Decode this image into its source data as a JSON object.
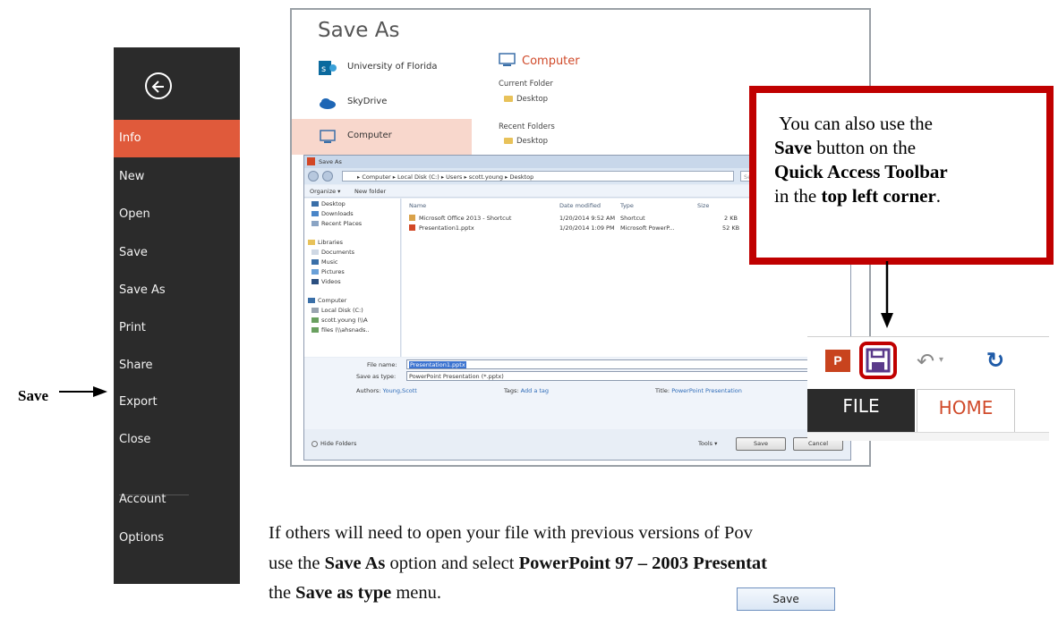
{
  "backstage": {
    "items": [
      {
        "label": "Info",
        "active": true
      },
      {
        "label": "New"
      },
      {
        "label": "Open"
      },
      {
        "label": "Save"
      },
      {
        "label": "Save As"
      },
      {
        "label": "Print"
      },
      {
        "label": "Share"
      },
      {
        "label": "Export"
      },
      {
        "label": "Close"
      },
      {
        "label": "Account"
      },
      {
        "label": "Options"
      }
    ],
    "accent_color": "#e05a3b"
  },
  "annotation": {
    "save_label": "Save"
  },
  "saveas_panel": {
    "title": "Save As",
    "places": [
      {
        "label": "University of Florida",
        "icon": "sharepoint-icon"
      },
      {
        "label": "SkyDrive",
        "icon": "cloud-icon"
      },
      {
        "label": "Computer",
        "icon": "computer-icon"
      }
    ],
    "computer_heading": "Computer",
    "current_folder_label": "Current Folder",
    "current_folder": "Desktop",
    "recent_folders_label": "Recent Folders",
    "recent_folder": "Desktop"
  },
  "dialog": {
    "title": "Save As",
    "address": "▸ Computer ▸ Local Disk (C:) ▸ Users ▸ scott.young ▸ Desktop",
    "search_placeholder": "Se",
    "toolbar": {
      "organize": "Organize ▾",
      "new_folder": "New folder"
    },
    "tree": {
      "favorites": [
        "Desktop",
        "Downloads",
        "Recent Places"
      ],
      "libraries_label": "Libraries",
      "libraries": [
        "Documents",
        "Music",
        "Pictures",
        "Videos"
      ],
      "computer_label": "Computer",
      "drives": [
        "Local Disk (C:)",
        "scott.young (\\\\A",
        "files (\\\\ahsnads.."
      ]
    },
    "columns": {
      "name": "Name",
      "date": "Date modified",
      "type": "Type",
      "size": "Size"
    },
    "files": [
      {
        "name": "Microsoft Office 2013 - Shortcut",
        "date": "1/20/2014 9:52 AM",
        "type": "Shortcut",
        "size": "2 KB"
      },
      {
        "name": "Presentation1.pptx",
        "date": "1/20/2014 1:09 PM",
        "type": "Microsoft PowerP...",
        "size": "52 KB"
      }
    ],
    "file_name_label": "File name:",
    "file_name": "Presentation1.pptx",
    "save_type_label": "Save as type:",
    "save_type": "PowerPoint Presentation (*.pptx)",
    "authors_label": "Authors:",
    "authors": "Young,Scott",
    "tags_label": "Tags:",
    "tags": "Add a tag",
    "title_label": "Title:",
    "title_value": "PowerPoint Presentation",
    "hide_folders": "Hide Folders",
    "tools": "Tools ▾",
    "save_button": "Save",
    "cancel_button": "Cancel"
  },
  "callout": {
    "line1": "You can also use the",
    "line2_bold": "Save",
    "line2_rest": " button on the",
    "line3_bold": "Quick Access Toolbar",
    "line4_pre": "in the ",
    "line4_bold": "top left corner",
    "line4_post": ".",
    "border_color": "#c00000"
  },
  "ribbon": {
    "ppt_icon": "P",
    "file_tab": "FILE",
    "home_tab": "HOME"
  },
  "body_text": {
    "line1": "If others will need to open your file with previous versions of Pov",
    "line2_pre": "use the ",
    "line2_bold1": "Save As",
    "line2_mid": " option and select ",
    "line2_bold2": "PowerPoint 97 – 2003 Presentat",
    "line3_pre": "the ",
    "line3_bold": "Save as type",
    "line3_post": " menu.",
    "sample_button": "Save"
  }
}
